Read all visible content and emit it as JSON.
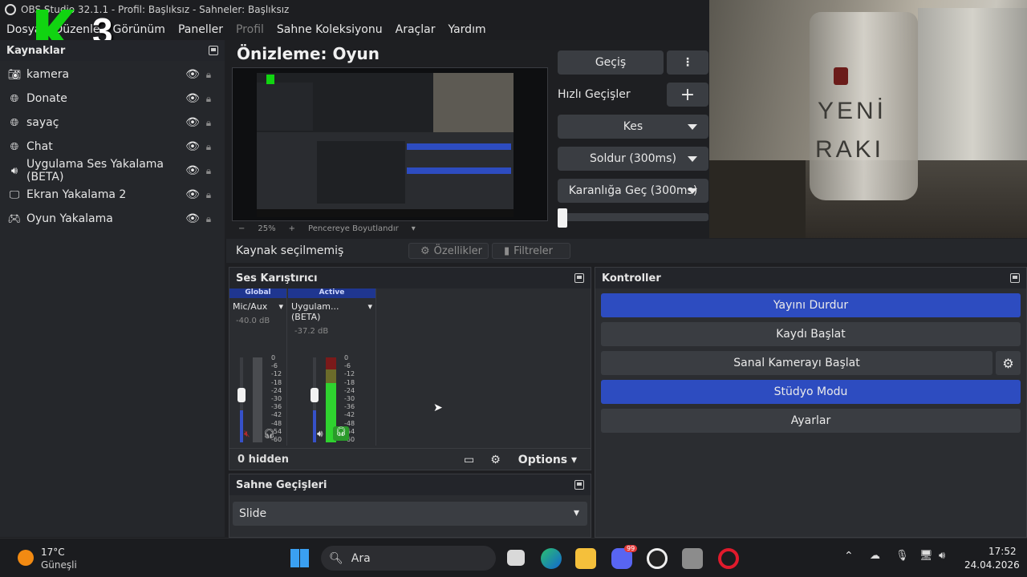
{
  "window": {
    "title": "OBS Studio 32.1.1 - Profil: Başlıksız - Sahneler: Başlıksız"
  },
  "menu": [
    "Dosya",
    "Düzenle",
    "Görünüm",
    "Paneller",
    "Profil",
    "Sahne Koleksiyonu",
    "Araçlar",
    "Yardım"
  ],
  "overlay_logo": "3",
  "sources": {
    "title": "Kaynaklar",
    "items": [
      {
        "name": "kamera",
        "icon": "camera-icon"
      },
      {
        "name": "Donate",
        "icon": "browser-globe-icon"
      },
      {
        "name": "sayaç",
        "icon": "browser-globe-icon"
      },
      {
        "name": "Chat",
        "icon": "browser-globe-icon"
      },
      {
        "name": "Uygulama Ses Yakalama (BETA)",
        "icon": "audio-capture-icon"
      },
      {
        "name": "Ekran Yakalama 2",
        "icon": "monitor-icon"
      },
      {
        "name": "Oyun Yakalama",
        "icon": "gamepad-icon"
      }
    ]
  },
  "preview": {
    "title": "Önizleme: Oyun",
    "zoom": "25%",
    "fit_label": "Pencereye Boyutlandır"
  },
  "transitions_panel": {
    "gecis": "Geçiş",
    "hizli": "Hızlı Geçişler",
    "kes": "Kes",
    "soldur": "Soldur (300ms)",
    "karanliga": "Karanlığa Geç (300ms)"
  },
  "source_bar": {
    "status": "Kaynak seçilmemiş",
    "properties": "Özellikler",
    "filters": "Filtreler"
  },
  "mixer": {
    "title": "Ses Karıştırıcı",
    "tracks": [
      {
        "tag": "Global",
        "name": "Mic/Aux",
        "db": "-40.0 dB",
        "muted": true
      },
      {
        "tag": "Active",
        "name": "Uygulam... (BETA)",
        "db": "-37.2 dB",
        "muted": false
      }
    ],
    "scale": [
      "0",
      "-6",
      "-12",
      "-18",
      "-24",
      "-30",
      "-36",
      "-42",
      "-48",
      "-54",
      "-60"
    ],
    "hidden": "0 hidden",
    "options": "Options"
  },
  "controls": {
    "title": "Kontroller",
    "buttons": [
      "Yayını Durdur",
      "Kaydı Başlat",
      "Sanal Kamerayı Başlat",
      "Stüdyo Modu",
      "Ayarlar"
    ]
  },
  "scene_transitions": {
    "title": "Sahne Geçişleri",
    "value": "Slide"
  },
  "webcam": {
    "bottle_text_1": "YENİ",
    "bottle_text_2": "RAKI"
  },
  "taskbar": {
    "temp": "17°C",
    "weather": "Güneşli",
    "search": "Ara",
    "time": "17:52",
    "date": "24.04.2026",
    "discord_badge": "99"
  },
  "colors": {
    "accent_blue": "#2d4cc0",
    "panel": "#2b2d31",
    "meter_green": "#2fd22f",
    "meter_red": "#7a1a1a"
  }
}
